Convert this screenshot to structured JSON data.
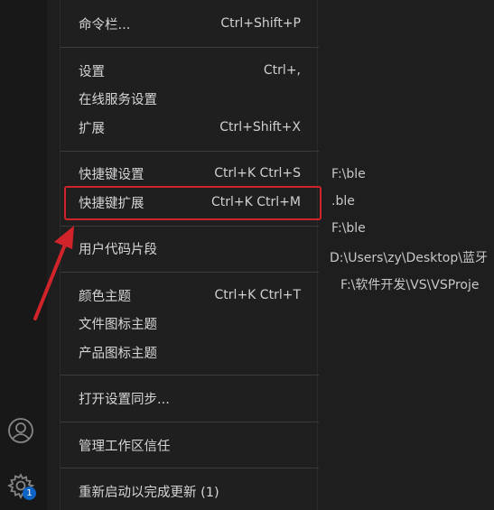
{
  "menu": {
    "items": [
      {
        "label": "命令栏...",
        "shortcut": "Ctrl+Shift+P"
      },
      {
        "label": "设置",
        "shortcut": "Ctrl+,"
      },
      {
        "label": "在线服务设置",
        "shortcut": ""
      },
      {
        "label": "扩展",
        "shortcut": "Ctrl+Shift+X"
      },
      {
        "label": "快捷键设置",
        "shortcut": "Ctrl+K Ctrl+S"
      },
      {
        "label": "快捷键扩展",
        "shortcut": "Ctrl+K Ctrl+M"
      },
      {
        "label": "用户代码片段",
        "shortcut": ""
      },
      {
        "label": "颜色主题",
        "shortcut": "Ctrl+K Ctrl+T"
      },
      {
        "label": "文件图标主题",
        "shortcut": ""
      },
      {
        "label": "产品图标主题",
        "shortcut": ""
      },
      {
        "label": "打开设置同步...",
        "shortcut": ""
      },
      {
        "label": "管理工作区信任",
        "shortcut": ""
      },
      {
        "label": "重新启动以完成更新 (1)",
        "shortcut": ""
      }
    ]
  },
  "background_text": [
    "F:\\ble",
    ".ble",
    "F:\\ble",
    "D:\\Users\\zy\\Desktop\\蓝牙",
    "F:\\软件开发\\VS\\VSProje"
  ],
  "activity_bar": {
    "manage_badge": "1"
  },
  "colors": {
    "highlight": "#d1242a",
    "badge": "#0e63c4"
  }
}
